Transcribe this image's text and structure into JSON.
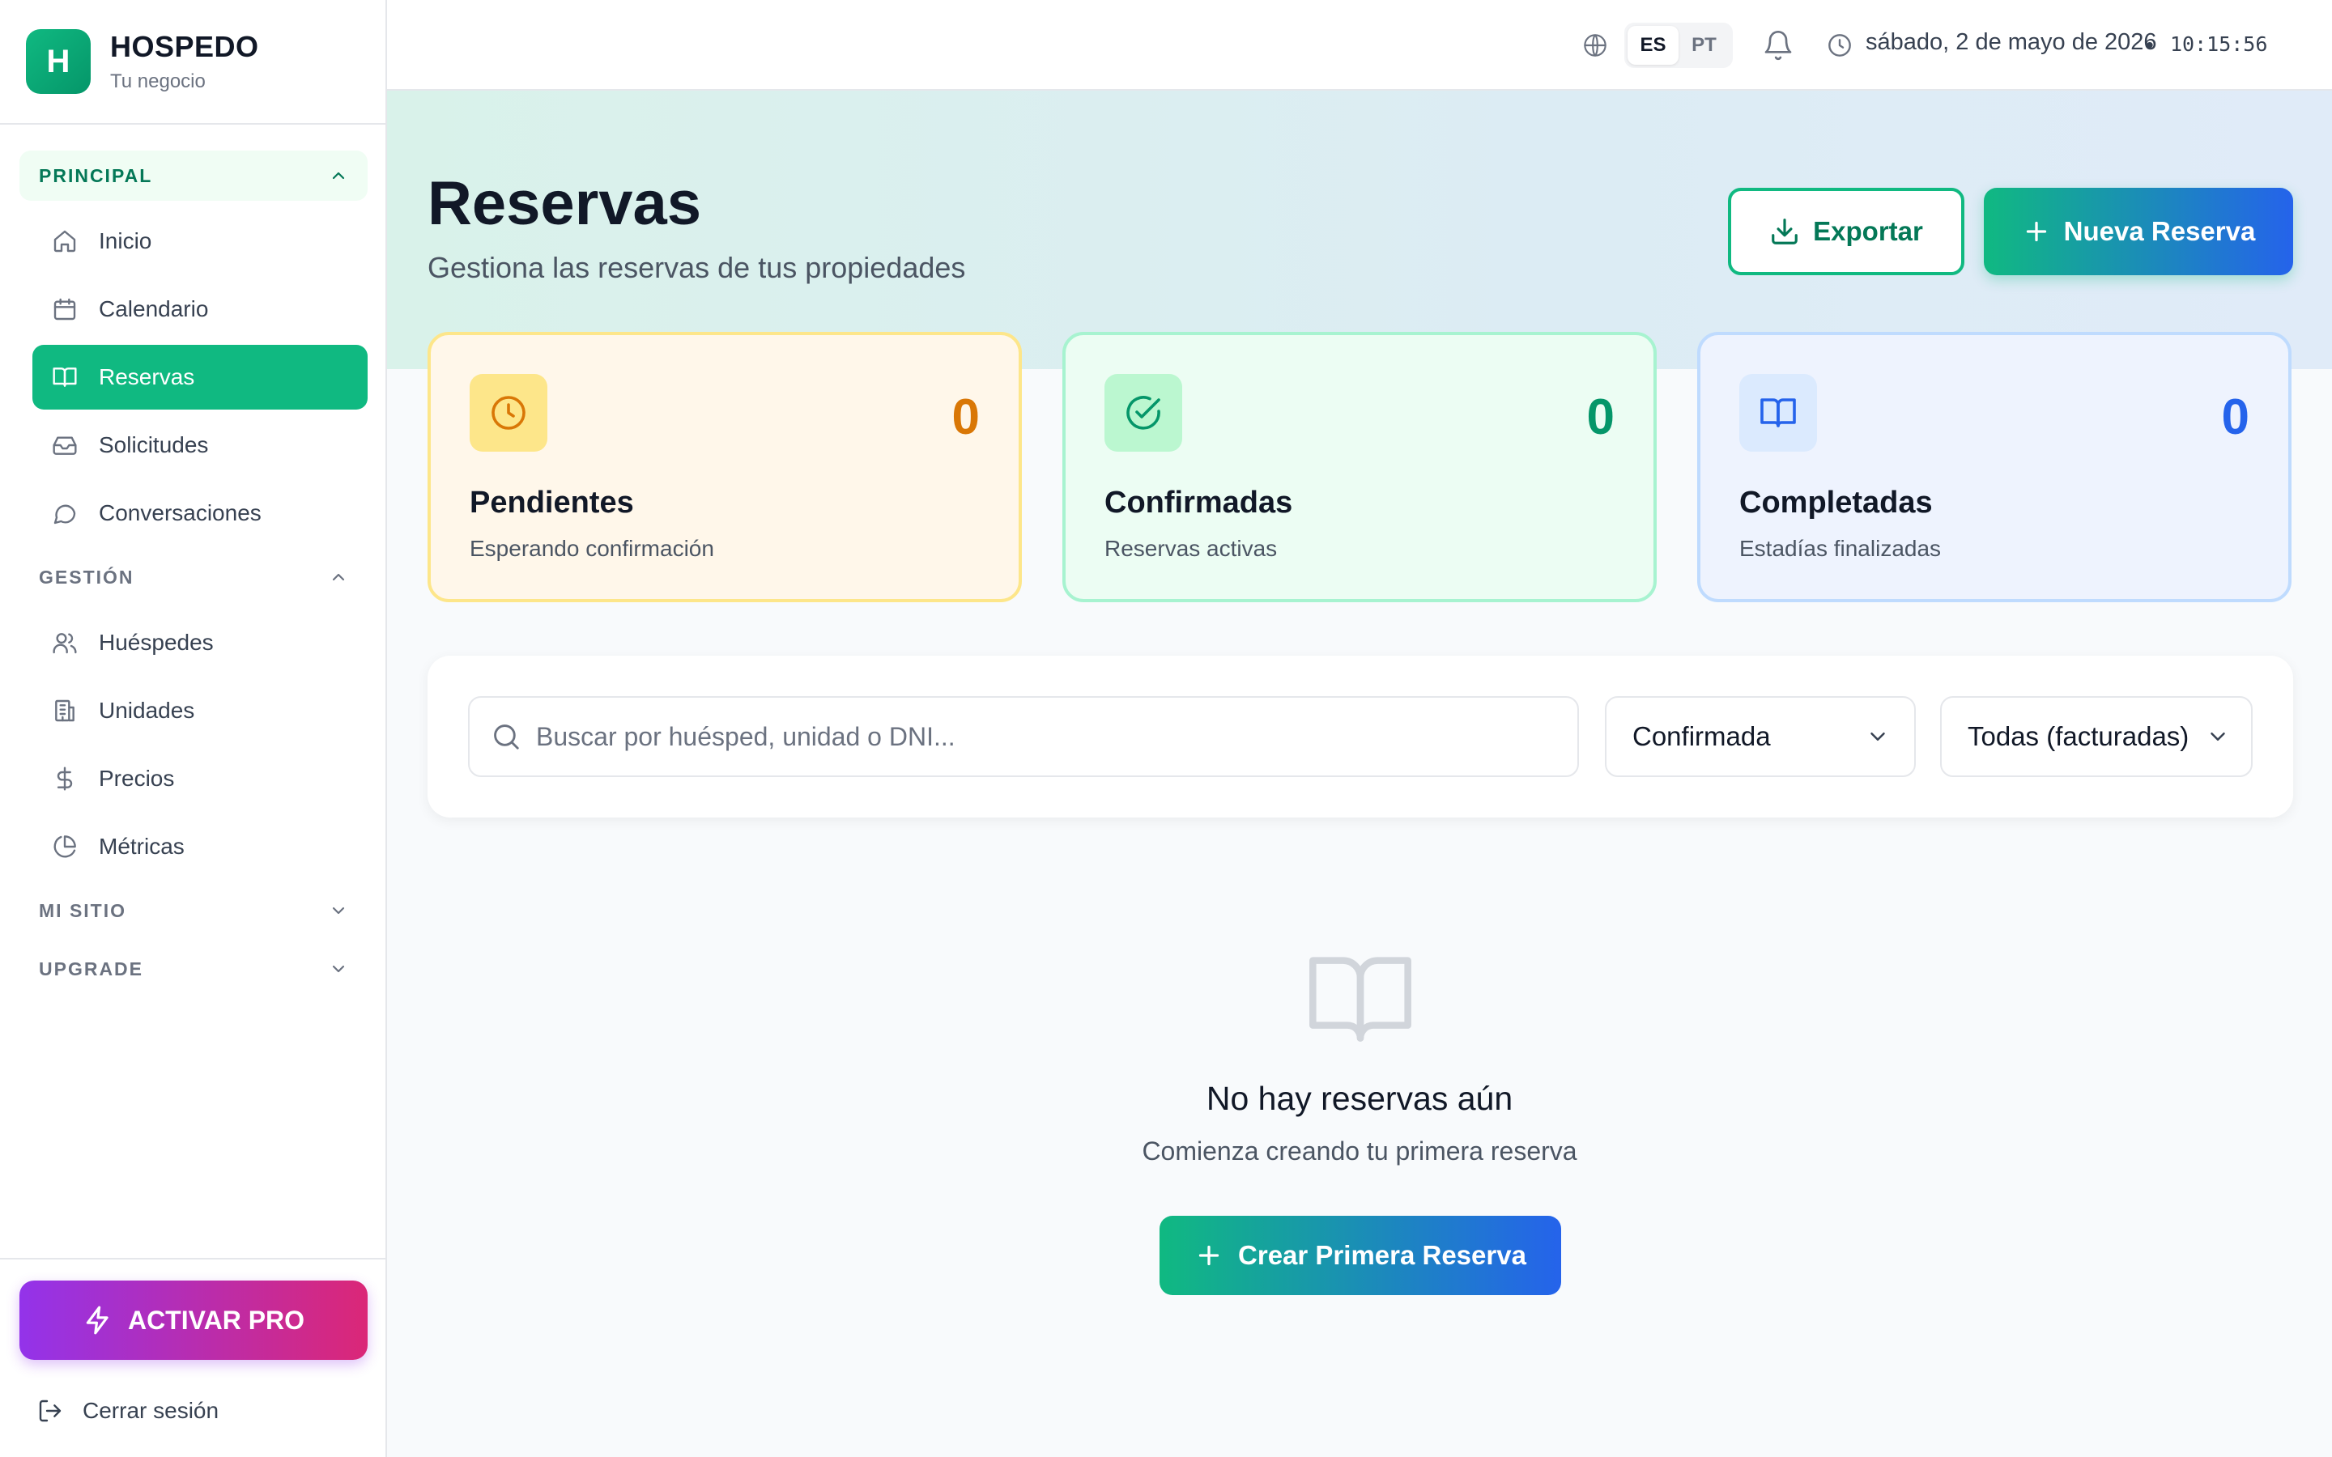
{
  "brand": {
    "logo_letter": "H",
    "name": "HOSPEDO",
    "subtitle": "Tu negocio"
  },
  "sidebar": {
    "sections": [
      {
        "label": "PRINCIPAL",
        "expanded": true,
        "items": [
          {
            "label": "Inicio",
            "icon": "home-icon"
          },
          {
            "label": "Calendario",
            "icon": "calendar-icon"
          },
          {
            "label": "Reservas",
            "icon": "book-open-icon",
            "active": true
          },
          {
            "label": "Solicitudes",
            "icon": "inbox-icon"
          },
          {
            "label": "Conversaciones",
            "icon": "chat-bubble-icon"
          }
        ]
      },
      {
        "label": "GESTIÓN",
        "expanded": true,
        "items": [
          {
            "label": "Huéspedes",
            "icon": "users-icon"
          },
          {
            "label": "Unidades",
            "icon": "building-icon"
          },
          {
            "label": "Precios",
            "icon": "dollar-icon"
          },
          {
            "label": "Métricas",
            "icon": "pie-chart-icon"
          }
        ]
      },
      {
        "label": "MI SITIO",
        "expanded": false,
        "items": []
      },
      {
        "label": "UPGRADE",
        "expanded": false,
        "items": []
      }
    ],
    "pro_button": "ACTIVAR PRO",
    "logout": "Cerrar sesión"
  },
  "topbar": {
    "languages": [
      "ES",
      "PT"
    ],
    "active_language": "ES",
    "date": "sábado, 2 de mayo de 2026",
    "separator": "•",
    "time": "10:15:56"
  },
  "page": {
    "title": "Reservas",
    "subtitle": "Gestiona las reservas de tus propiedades",
    "export_label": "Exportar",
    "new_label": "Nueva Reserva"
  },
  "stats": [
    {
      "key": "pending",
      "value": "0",
      "label": "Pendientes",
      "desc": "Esperando confirmación",
      "color": "#d97706"
    },
    {
      "key": "confirmed",
      "value": "0",
      "label": "Confirmadas",
      "desc": "Reservas activas",
      "color": "#059669"
    },
    {
      "key": "completed",
      "value": "0",
      "label": "Completadas",
      "desc": "Estadías finalizadas",
      "color": "#2563eb"
    }
  ],
  "filters": {
    "search_placeholder": "Buscar por huésped, unidad o DNI...",
    "status_value": "Confirmada",
    "billing_value": "Todas (facturadas)"
  },
  "empty": {
    "title": "No hay reservas aún",
    "subtitle": "Comienza creando tu primera reserva",
    "button": "Crear Primera Reserva"
  },
  "colors": {
    "accent": "#10b981",
    "accent_dark": "#047857",
    "blue": "#2563eb",
    "pro_start": "#9333ea",
    "pro_end": "#db2777"
  }
}
